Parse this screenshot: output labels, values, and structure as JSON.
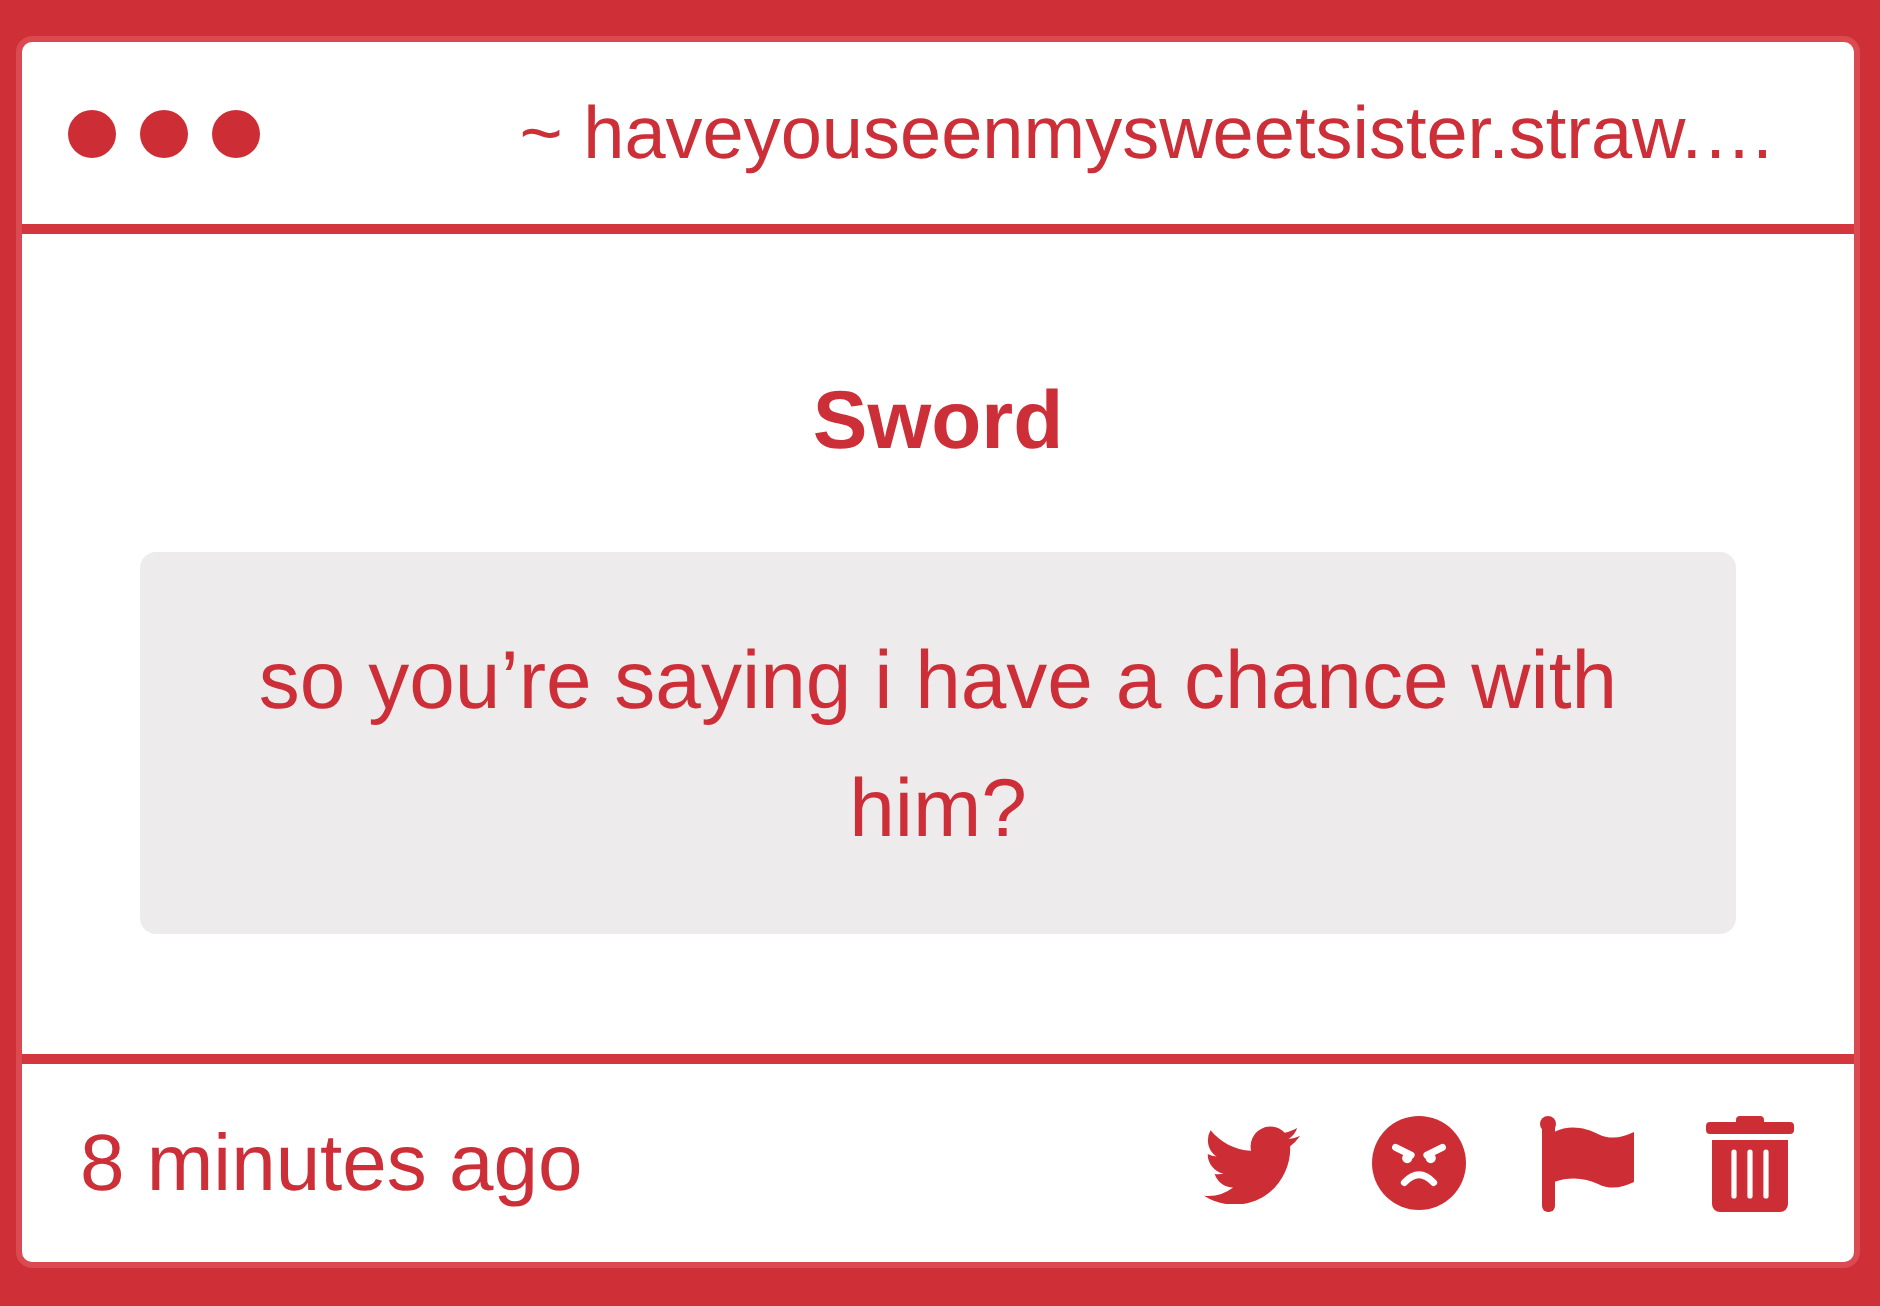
{
  "header": {
    "url": "~ haveyouseenmysweetsister.straw.…"
  },
  "post": {
    "title": "Sword",
    "message": "so you’re saying i have a chance with him?"
  },
  "footer": {
    "timestamp": "8 minutes ago"
  }
}
